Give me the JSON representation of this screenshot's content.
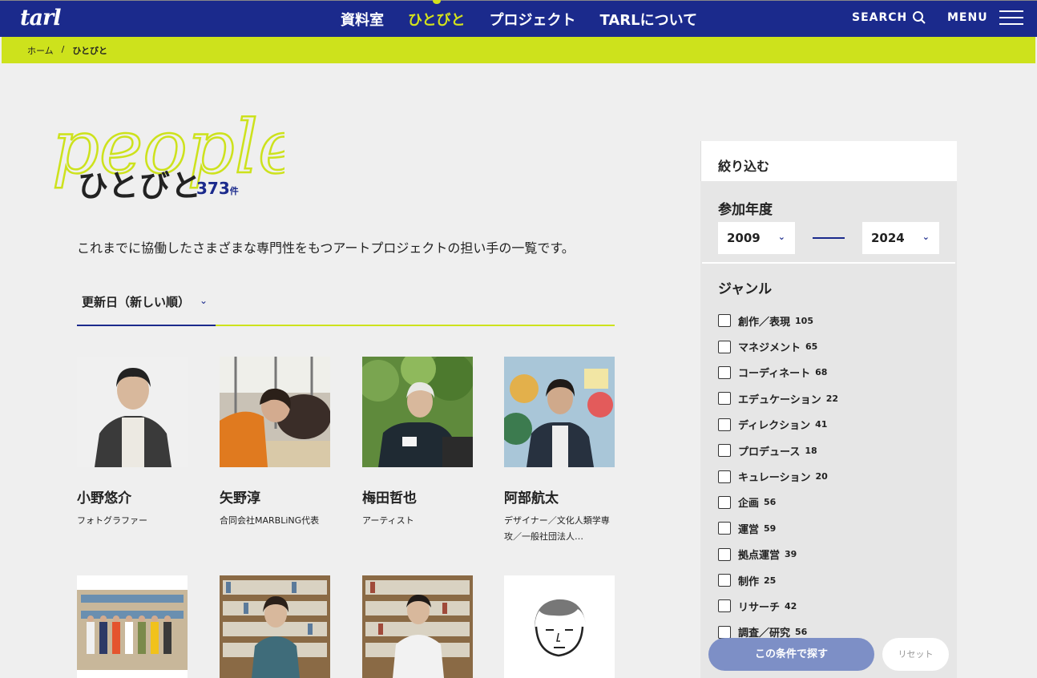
{
  "header": {
    "logo": "tarl",
    "nav": [
      "資料室",
      "ひとびと",
      "プロジェクト",
      "TARLについて"
    ],
    "search_label": "SEARCH",
    "menu_label": "MENU"
  },
  "breadcrumb": {
    "home": "ホーム",
    "sep": "/",
    "current": "ひとびと"
  },
  "page": {
    "script_title": "people",
    "title": "ひとびと",
    "count": "373",
    "count_unit": "件",
    "description": "これまでに協働したさまざまな専門性をもつアートプロジェクトの担い手の一覧です。",
    "sort_label": "更新日（新しい順）"
  },
  "people": [
    {
      "name": "小野悠介",
      "role": "フォトグラファー"
    },
    {
      "name": "矢野淳",
      "role": "合同会社MARBLiNG代表"
    },
    {
      "name": "梅田哲也",
      "role": "アーティスト"
    },
    {
      "name": "阿部航太",
      "role": "デザイナー／文化人類学専攻／一般社団法人…"
    }
  ],
  "filter": {
    "title": "絞り込む",
    "year_title": "参加年度",
    "year_from": "2009",
    "year_to": "2024",
    "genre_title": "ジャンル",
    "genres": [
      {
        "label": "創作／表現",
        "count": "105"
      },
      {
        "label": "マネジメント",
        "count": "65"
      },
      {
        "label": "コーディネート",
        "count": "68"
      },
      {
        "label": "エデュケーション",
        "count": "22"
      },
      {
        "label": "ディレクション",
        "count": "41"
      },
      {
        "label": "プロデュース",
        "count": "18"
      },
      {
        "label": "キュレーション",
        "count": "20"
      },
      {
        "label": "企画",
        "count": "56"
      },
      {
        "label": "運営",
        "count": "59"
      },
      {
        "label": "拠点運営",
        "count": "39"
      },
      {
        "label": "制作",
        "count": "25"
      },
      {
        "label": "リサーチ",
        "count": "42"
      },
      {
        "label": "調査／研究",
        "count": "56"
      }
    ],
    "search_button": "この条件で探す",
    "reset_button": "リセット"
  },
  "colors": {
    "navy": "#1b2a8c",
    "lime": "#cde21c",
    "bg": "#efefef"
  }
}
